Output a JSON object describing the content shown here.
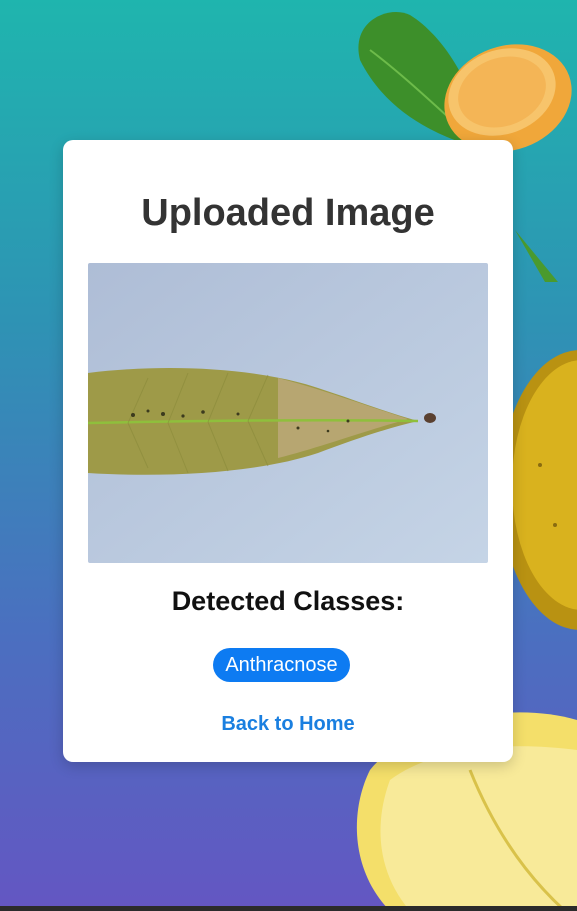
{
  "card": {
    "title": "Uploaded Image",
    "classes_heading": "Detected Classes:",
    "detected_classes": [
      "Anthracnose"
    ],
    "back_link": "Back to Home"
  },
  "colors": {
    "badge": "#0d7bf2",
    "link": "#1a7fe0",
    "background_top": "#1fb5ae",
    "background_bottom": "#6456c2"
  }
}
